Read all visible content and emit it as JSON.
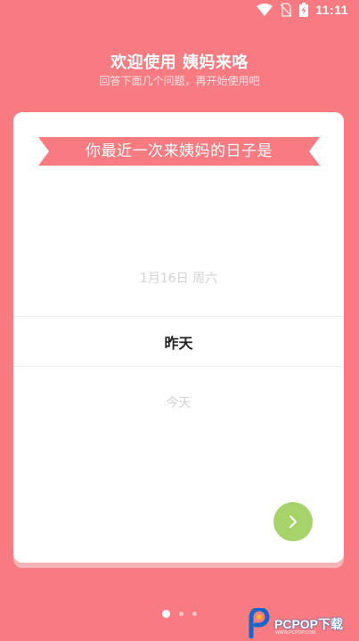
{
  "status_bar": {
    "time": "11:11",
    "icons": [
      "wifi-icon",
      "no-sim-icon",
      "battery-charging-icon"
    ]
  },
  "header": {
    "title": "欢迎使用 姨妈来咯",
    "subtitle": "回答下面几个问题，再开始使用吧"
  },
  "question": {
    "text": "你最近一次来姨妈的日子是"
  },
  "picker": {
    "prev": "1月16日 周六",
    "selected": "昨天",
    "next": "今天"
  },
  "next_button": {
    "icon": "chevron-right-icon"
  },
  "pager": {
    "count": 3,
    "active": 0
  },
  "watermark": {
    "text": "PCPOP下载",
    "subtext": "WWW.PCPOP.COM"
  },
  "colors": {
    "background": "#f77b80",
    "ribbon": "#f77b80",
    "next_button": "#a6d46b",
    "card": "#ffffff"
  }
}
